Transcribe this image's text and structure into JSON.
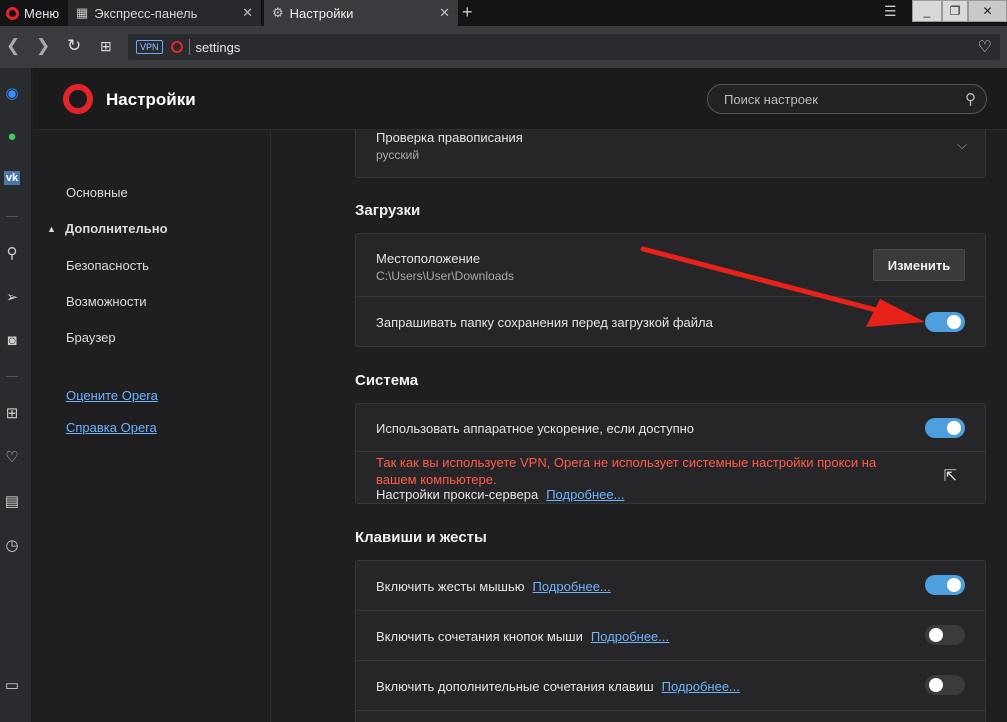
{
  "tabbar": {
    "menu_label": "Меню",
    "tabs": [
      {
        "label": "Экспресс-панель",
        "icon": "grid-icon"
      },
      {
        "label": "Настройки",
        "icon": "gear-icon"
      }
    ]
  },
  "address": {
    "vpn_label": "VPN",
    "url": "settings"
  },
  "sidebar": {
    "icons": [
      "messenger-icon",
      "whatsapp-icon",
      "vk-icon",
      "search-icon",
      "send-icon",
      "camera-icon",
      "speed-dial-icon",
      "heart-icon",
      "news-icon",
      "history-icon",
      "sidebar-toggle-icon"
    ]
  },
  "header": {
    "title": "Настройки",
    "search_placeholder": "Поиск настроек"
  },
  "nav": {
    "items": [
      "Основные",
      "Дополнительно",
      "Безопасность",
      "Возможности",
      "Браузер"
    ],
    "links": [
      "Оцените Opera",
      "Справка Opera"
    ]
  },
  "spellcheck": {
    "title": "Проверка правописания",
    "value": "русский"
  },
  "downloads": {
    "section": "Загрузки",
    "location_title": "Местоположение",
    "location_path": "C:\\Users\\User\\Downloads",
    "change_button": "Изменить",
    "ask_label": "Запрашивать папку сохранения перед загрузкой файла",
    "ask_on": true
  },
  "system": {
    "section": "Система",
    "hw_label": "Использовать аппаратное ускорение, если доступно",
    "hw_on": true,
    "vpn_warning": "Так как вы используете VPN, Opera не использует системные настройки прокси на вашем компьютере.",
    "proxy_label": "Настройки прокси-сервера",
    "proxy_link": "Подробнее..."
  },
  "keys": {
    "section": "Клавиши и жесты",
    "rows": [
      {
        "label": "Включить жесты мышью",
        "link": "Подробнее...",
        "on": true
      },
      {
        "label": "Включить сочетания кнопок мыши",
        "link": "Подробнее...",
        "on": false
      },
      {
        "label": "Включить дополнительные сочетания клавиш",
        "link": "Подробнее...",
        "on": false
      }
    ]
  },
  "colors": {
    "accent": "#4d9fde",
    "opera_red": "#e3242b",
    "warning": "#ff5a4a",
    "arrow": "#e8211b"
  }
}
